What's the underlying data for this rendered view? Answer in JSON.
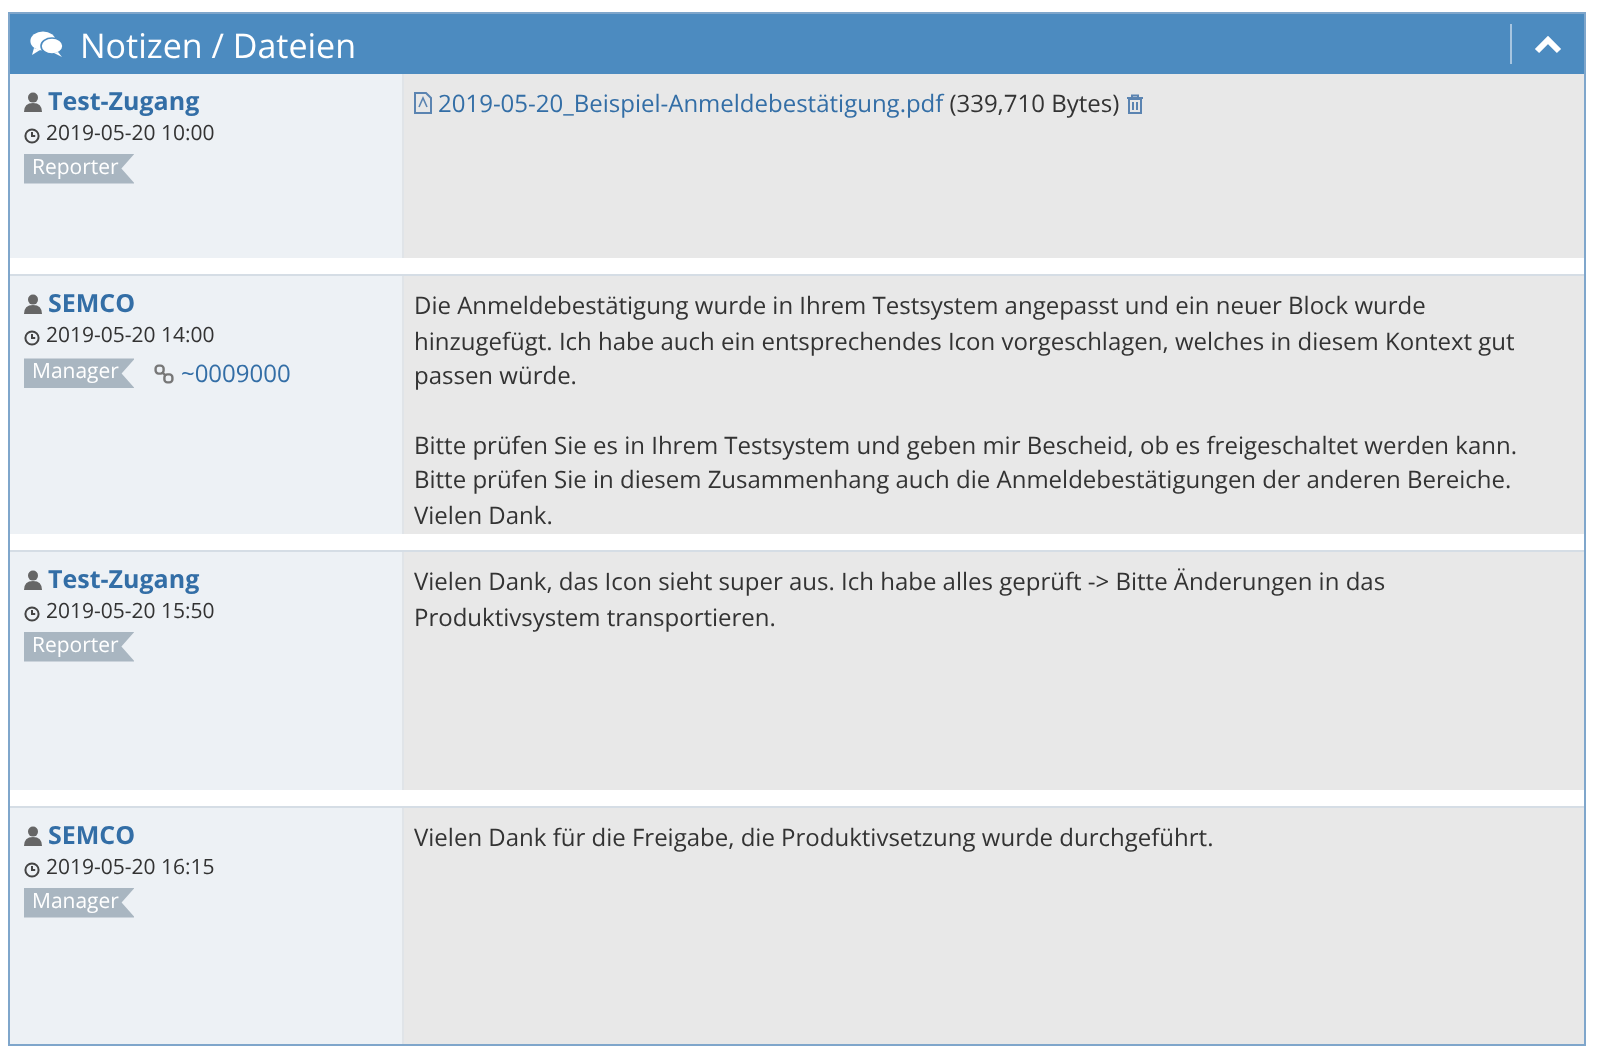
{
  "panel": {
    "title": "Notizen / Dateien",
    "collapsed": false
  },
  "notes": [
    {
      "author": "Test-Zugang",
      "time": "2019-05-20 10:00",
      "role": "Reporter",
      "kind": "file",
      "file": {
        "name": "2019-05-20_Beispiel-Anmeldebestätigung.pdf",
        "size": "(339,710 Bytes)"
      }
    },
    {
      "author": "SEMCO",
      "time": "2019-05-20 14:00",
      "role": "Manager",
      "issue": "~0009000",
      "kind": "text",
      "paragraphs": [
        "Die Anmeldebestätigung wurde in Ihrem Testsystem angepasst und ein neuer Block wurde hinzugefügt. Ich habe auch ein entsprechendes Icon vorgeschlagen, welches in diesem Kontext gut passen würde.",
        "Bitte prüfen Sie es in Ihrem Testsystem und geben mir Bescheid, ob es freigeschaltet werden kann.\nBitte prüfen Sie in diesem Zusammenhang auch die Anmeldebestätigungen der anderen Bereiche.\nVielen Dank."
      ]
    },
    {
      "author": "Test-Zugang",
      "time": "2019-05-20 15:50",
      "role": "Reporter",
      "kind": "text",
      "paragraphs": [
        "Vielen Dank, das Icon sieht super aus. Ich habe alles geprüft -> Bitte Änderungen in das Produktivsystem transportieren."
      ]
    },
    {
      "author": "SEMCO",
      "time": "2019-05-20 16:15",
      "role": "Manager",
      "kind": "text",
      "paragraphs": [
        "Vielen Dank für die Freigabe, die Produktivsetzung wurde durchgeführt."
      ]
    }
  ]
}
